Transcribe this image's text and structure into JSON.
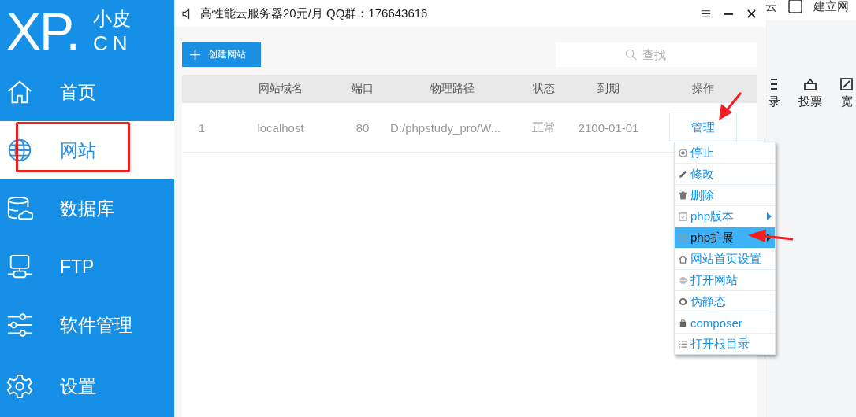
{
  "logo": {
    "mark": "XP.",
    "name_top": "小皮",
    "name_bottom": "CN"
  },
  "sidebar": {
    "items": [
      {
        "label": "首页",
        "selected": false
      },
      {
        "label": "网站",
        "selected": true
      },
      {
        "label": "数据库",
        "selected": false
      },
      {
        "label": "FTP",
        "selected": false
      },
      {
        "label": "软件管理",
        "selected": false
      },
      {
        "label": "设置",
        "selected": false
      }
    ]
  },
  "window": {
    "title": "高性能云服务器20元/月  QQ群：176643616"
  },
  "toolbar": {
    "create_button": "创建网站",
    "search": {
      "placeholder": "查找"
    }
  },
  "table": {
    "columns": [
      "网站域名",
      "端口",
      "物理路径",
      "状态",
      "到期",
      "操作"
    ],
    "rows": [
      {
        "index": "1",
        "domain": "localhost",
        "port": "80",
        "path": "D:/phpstudy_pro/W...",
        "status": "正常",
        "expiry": "2100-01-01",
        "action": "管理"
      }
    ]
  },
  "context_menu": {
    "items": [
      {
        "label": "停止",
        "submenu": false,
        "selected": false
      },
      {
        "label": "修改",
        "submenu": false,
        "selected": false
      },
      {
        "label": "删除",
        "submenu": false,
        "selected": false
      },
      {
        "label": "php版本",
        "submenu": true,
        "selected": false
      },
      {
        "label": "php扩展",
        "submenu": true,
        "selected": true
      },
      {
        "label": "网站首页设置",
        "submenu": false,
        "selected": false
      },
      {
        "label": "打开网站",
        "submenu": false,
        "selected": false
      },
      {
        "label": "伪静态",
        "submenu": false,
        "selected": false
      },
      {
        "label": "composer",
        "submenu": false,
        "selected": false
      },
      {
        "label": "打开根目录",
        "submenu": false,
        "selected": false
      }
    ]
  },
  "background_window": {
    "top_texts": [
      "云",
      "建立网"
    ],
    "tools": [
      {
        "label": "录"
      },
      {
        "label": "投票"
      },
      {
        "label": "宽"
      }
    ]
  }
}
